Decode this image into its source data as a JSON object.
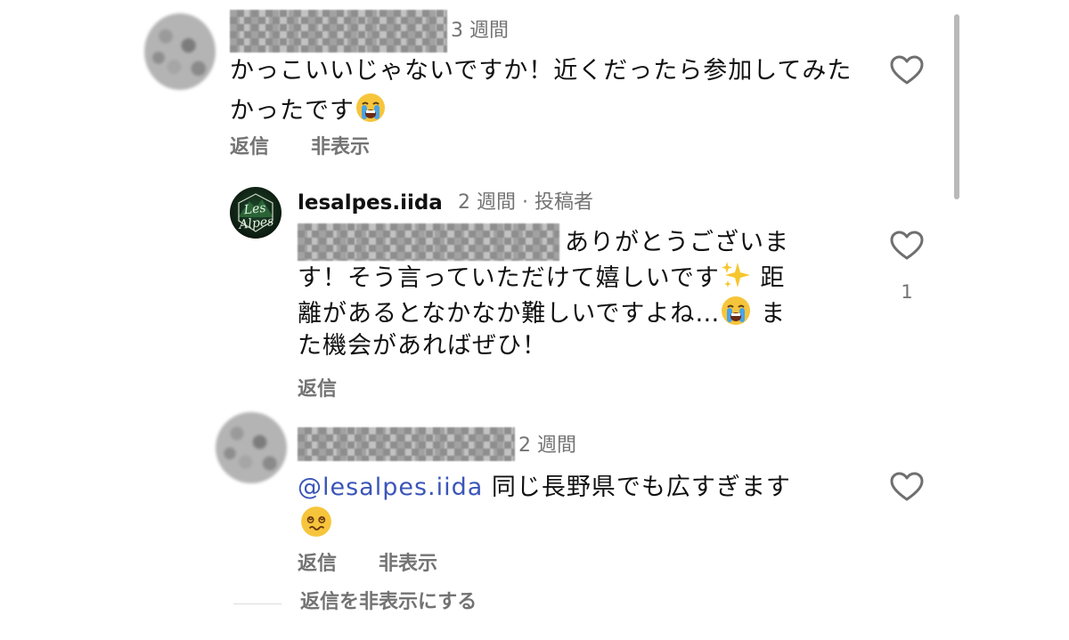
{
  "comments": [
    {
      "time": "3 週間",
      "text": "かっこいいじゃないですか！近くだったら参加してみたかったです",
      "actions": {
        "reply": "返信",
        "hide": "非表示"
      }
    },
    {
      "username": "lesalpes.iida",
      "time": "2 週間 · 投稿者",
      "avatar_logo": "Les Alpes",
      "text_line1": "ありがとうございま",
      "text_line2": "す！そう言っていただけて嬉しいです",
      "text_line2b": " 距",
      "text_line3": "離があるとなかなか難しいですよね…",
      "text_line3b": " ま",
      "text_line4": "た機会があればぜひ！",
      "like_count": "1",
      "actions": {
        "reply": "返信"
      }
    },
    {
      "time": "2 週間",
      "mention": "@lesalpes.iida",
      "text": " 同じ長野県でも広すぎます",
      "actions": {
        "reply": "返信",
        "hide": "非表示"
      }
    }
  ],
  "hide_replies": "返信を非表示にする",
  "icons": [
    "heart-outline-icon",
    "crying-face-emoji",
    "sparkles-emoji",
    "dizzy-face-emoji"
  ],
  "colors": {
    "mention": "#3b55b8",
    "meta": "#737373",
    "text": "#111111"
  }
}
